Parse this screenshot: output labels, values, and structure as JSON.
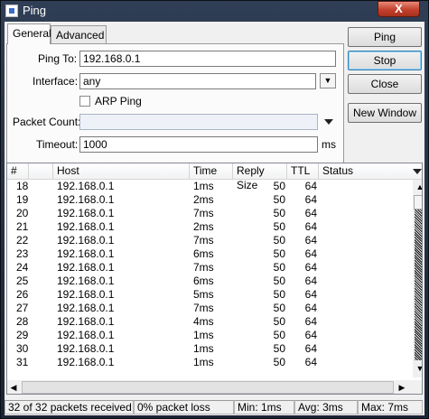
{
  "window": {
    "title": "Ping",
    "close_label": "X"
  },
  "tabs": [
    {
      "label": "General"
    },
    {
      "label": "Advanced"
    }
  ],
  "form": {
    "ping_to_label": "Ping To:",
    "ping_to_value": "192.168.0.1",
    "interface_label": "Interface:",
    "interface_value": "any",
    "arp_ping_label": "ARP Ping",
    "packet_count_label": "Packet Count:",
    "packet_count_value": "",
    "timeout_label": "Timeout:",
    "timeout_value": "1000",
    "timeout_unit": "ms"
  },
  "buttons": {
    "ping": "Ping",
    "stop": "Stop",
    "close": "Close",
    "new_window": "New Window"
  },
  "table": {
    "columns": [
      "#",
      "",
      "Host",
      "Time",
      "Reply Size",
      "TTL",
      "Status"
    ],
    "rows": [
      {
        "num": "18",
        "host": "192.168.0.1",
        "time": "1ms",
        "size": "50",
        "ttl": "64",
        "status": ""
      },
      {
        "num": "19",
        "host": "192.168.0.1",
        "time": "2ms",
        "size": "50",
        "ttl": "64",
        "status": ""
      },
      {
        "num": "20",
        "host": "192.168.0.1",
        "time": "7ms",
        "size": "50",
        "ttl": "64",
        "status": ""
      },
      {
        "num": "21",
        "host": "192.168.0.1",
        "time": "2ms",
        "size": "50",
        "ttl": "64",
        "status": ""
      },
      {
        "num": "22",
        "host": "192.168.0.1",
        "time": "7ms",
        "size": "50",
        "ttl": "64",
        "status": ""
      },
      {
        "num": "23",
        "host": "192.168.0.1",
        "time": "6ms",
        "size": "50",
        "ttl": "64",
        "status": ""
      },
      {
        "num": "24",
        "host": "192.168.0.1",
        "time": "7ms",
        "size": "50",
        "ttl": "64",
        "status": ""
      },
      {
        "num": "25",
        "host": "192.168.0.1",
        "time": "6ms",
        "size": "50",
        "ttl": "64",
        "status": ""
      },
      {
        "num": "26",
        "host": "192.168.0.1",
        "time": "5ms",
        "size": "50",
        "ttl": "64",
        "status": ""
      },
      {
        "num": "27",
        "host": "192.168.0.1",
        "time": "7ms",
        "size": "50",
        "ttl": "64",
        "status": ""
      },
      {
        "num": "28",
        "host": "192.168.0.1",
        "time": "4ms",
        "size": "50",
        "ttl": "64",
        "status": ""
      },
      {
        "num": "29",
        "host": "192.168.0.1",
        "time": "1ms",
        "size": "50",
        "ttl": "64",
        "status": ""
      },
      {
        "num": "30",
        "host": "192.168.0.1",
        "time": "1ms",
        "size": "50",
        "ttl": "64",
        "status": ""
      },
      {
        "num": "31",
        "host": "192.168.0.1",
        "time": "1ms",
        "size": "50",
        "ttl": "64",
        "status": ""
      }
    ]
  },
  "status_bar": {
    "received": "32 of 32 packets received",
    "loss": "0% packet loss",
    "min": "Min: 1ms",
    "avg": "Avg: 3ms",
    "max": "Max: 7ms"
  }
}
